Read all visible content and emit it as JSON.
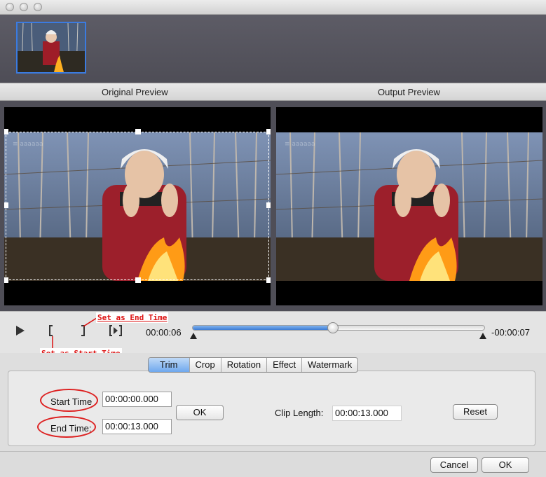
{
  "thumbnail": {
    "selected": true
  },
  "preview": {
    "original_label": "Original Preview",
    "output_label": "Output Preview",
    "watermark_text": "≡ aaaaaa"
  },
  "player": {
    "current_time": "00:00:06",
    "remaining_time": "-00:00:07",
    "progress": 0.48
  },
  "annotations": {
    "end_time": "Set as End Time",
    "start_time": "Set as Start Time"
  },
  "tabs": [
    "Trim",
    "Crop",
    "Rotation",
    "Effect",
    "Watermark"
  ],
  "active_tab": "Trim",
  "trim": {
    "start_label": "Start Time",
    "start_value": "00:00:00.000",
    "end_label": "End Time:",
    "end_value": "00:00:13.000",
    "ok_label": "OK",
    "clip_length_label": "Clip Length:",
    "clip_length_value": "00:00:13.000",
    "reset_label": "Reset"
  },
  "footer": {
    "cancel_label": "Cancel",
    "ok_label": "OK"
  },
  "colors": {
    "accent": "#3b7be0",
    "annotation": "#dd1111",
    "video_bg": "#000000"
  }
}
